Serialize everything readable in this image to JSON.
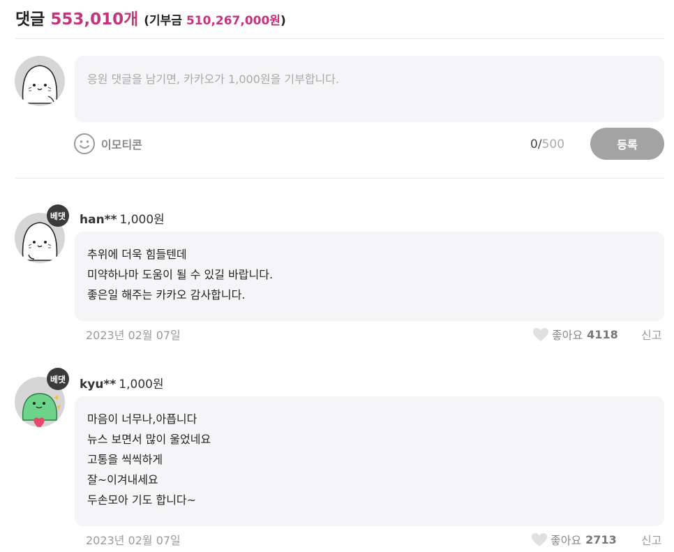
{
  "header": {
    "title": "댓글",
    "count": "553,010개",
    "donation_prefix": "(기부금",
    "donation_amount": "510,267,000원",
    "donation_suffix": ")"
  },
  "composer": {
    "placeholder": "응원 댓글을 남기면, 카카오가 1,000원을 기부합니다.",
    "emoticon_label": "이모티콘",
    "char_current": "0",
    "char_separator": "/",
    "char_max": "500",
    "submit_label": "등록"
  },
  "comments": [
    {
      "badge": "베댓",
      "nickname": "han**",
      "amount": "1,000원",
      "lines": [
        "추위에 더욱 힘들텐데",
        "미약하나마 도움이 될 수 있길 바랍니다.",
        "좋은일 해주는 카카오 감사합니다."
      ],
      "date": "2023년 02월 07일",
      "likes_label": "좋아요",
      "likes": "4118",
      "report_label": "신고"
    },
    {
      "badge": "베댓",
      "nickname": "kyu**",
      "amount": "1,000원",
      "lines": [
        "마음이 너무나,아픕니다",
        "뉴스 보면서 많이 울었네요",
        "고통을 씩씩하게",
        "잘~이겨내세요",
        "두손모아 기도 합니다~"
      ],
      "date": "2023년 02월 07일",
      "likes_label": "좋아요",
      "likes": "2713",
      "report_label": "신고"
    }
  ],
  "colors": {
    "accent": "#c2357d",
    "submit_bg": "#a3a3a3",
    "bubble_bg": "#f5f5f7",
    "badge_bg": "#3a3a3a"
  }
}
